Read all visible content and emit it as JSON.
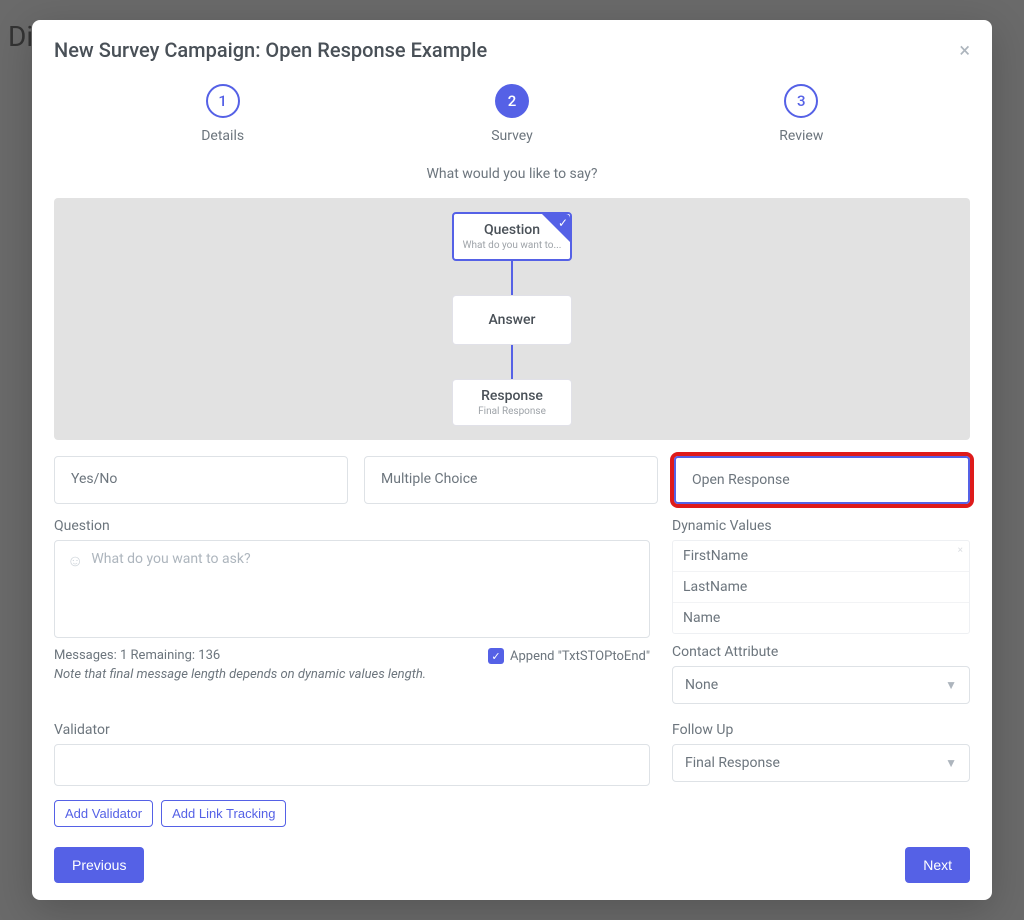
{
  "background": {
    "truncated_title": "Dia"
  },
  "modal": {
    "title": "New Survey Campaign: Open Response Example",
    "close": "×"
  },
  "steps": [
    {
      "num": "1",
      "label": "Details"
    },
    {
      "num": "2",
      "label": "Survey"
    },
    {
      "num": "3",
      "label": "Review"
    }
  ],
  "prompt": "What would you like to say?",
  "flow": {
    "question": {
      "title": "Question",
      "sub": "What do you want to..."
    },
    "answer": {
      "title": "Answer"
    },
    "response": {
      "title": "Response",
      "sub": "Final Response"
    }
  },
  "question_types": {
    "yes_no": "Yes/No",
    "multiple_choice": "Multiple Choice",
    "open_response": "Open Response"
  },
  "left": {
    "question_label": "Question",
    "question_placeholder": "What do you want to ask?",
    "counter": "Messages: 1 Remaining: 136",
    "note": "Note that final message length depends on dynamic values length.",
    "append_label": "Append \"TxtSTOPtoEnd\"",
    "validator_label": "Validator",
    "add_validator": "Add Validator",
    "add_link_tracking": "Add Link Tracking"
  },
  "right": {
    "dynamic_values_label": "Dynamic Values",
    "dv": [
      "FirstName",
      "LastName",
      "Name"
    ],
    "contact_attribute_label": "Contact Attribute",
    "contact_attribute_value": "None",
    "follow_up_label": "Follow Up",
    "follow_up_value": "Final Response"
  },
  "footer": {
    "previous": "Previous",
    "next": "Next"
  }
}
